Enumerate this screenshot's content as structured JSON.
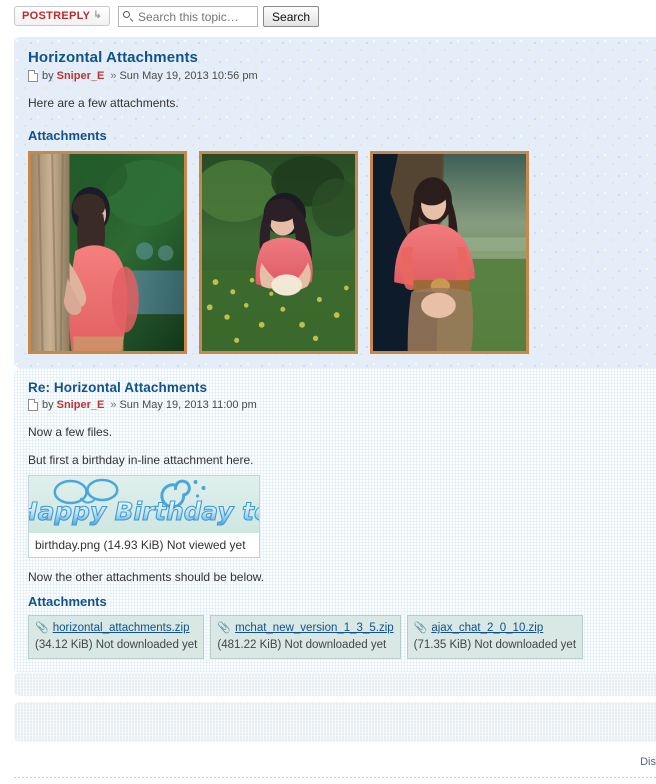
{
  "toolbar": {
    "postreply_label": "POSTREPLY",
    "postreply_icon": "reply-arrow-icon",
    "search_icon": "search-icon",
    "search_placeholder": "Search this topic…",
    "search_value": "",
    "search_button_label": "Search"
  },
  "posts": [
    {
      "title": "Horizontal Attachments",
      "post_icon": "post-page-icon",
      "by_label": "by",
      "author": "Sniper_E",
      "separator": "»",
      "date": "Sun May 19, 2013 10:56 pm",
      "body": "Here are a few attachments.",
      "attachments_heading": "Attachments",
      "thumbnails": [
        {
          "name": "girl-leaning-on-tree-photo",
          "alt": "Girl in pink top leaning against a tree"
        },
        {
          "name": "girl-in-flower-field-photo",
          "alt": "Girl kneeling in a field of yellow flowers"
        },
        {
          "name": "girl-standing-by-tree-photo",
          "alt": "Girl in pink top standing beside a tree"
        }
      ]
    },
    {
      "title": "Re: Horizontal Attachments",
      "post_icon": "post-page-icon",
      "by_label": "by",
      "author": "Sniper_E",
      "separator": "»",
      "date": "Sun May 19, 2013 11:00 pm",
      "body_1": "Now a few files.",
      "body_2": "But first a birthday in-line attachment here.",
      "inline_attachment": {
        "image_name": "happy-birthday-banner-image",
        "image_text": "Happy Birthday to",
        "caption": "birthday.png (14.93 KiB) Not viewed yet"
      },
      "body_3": "Now the other attachments should be below.",
      "attachments_heading": "Attachments",
      "files": [
        {
          "icon": "paperclip-icon",
          "filename": "horizontal_attachments.zip",
          "meta": "(34.12 KiB) Not downloaded yet"
        },
        {
          "icon": "paperclip-icon",
          "filename": "mchat_new_version_1_3_5.zip",
          "meta": "(481.22 KiB) Not downloaded yet"
        },
        {
          "icon": "paperclip-icon",
          "filename": "ajax_chat_2_0_10.zip",
          "meta": "(71.35 KiB) Not downloaded yet"
        }
      ]
    }
  ],
  "footer": {
    "truncated_text": "Dis"
  },
  "colors": {
    "link": "#105289",
    "author": "#bb3333",
    "postreply": "#bc2a2a",
    "post_bg_alt1": "#e5eef8",
    "post_bg_alt2": "#fbfdfe",
    "attachment_bg": "#d9e8e4",
    "thumb_frame": "#c8884a"
  }
}
